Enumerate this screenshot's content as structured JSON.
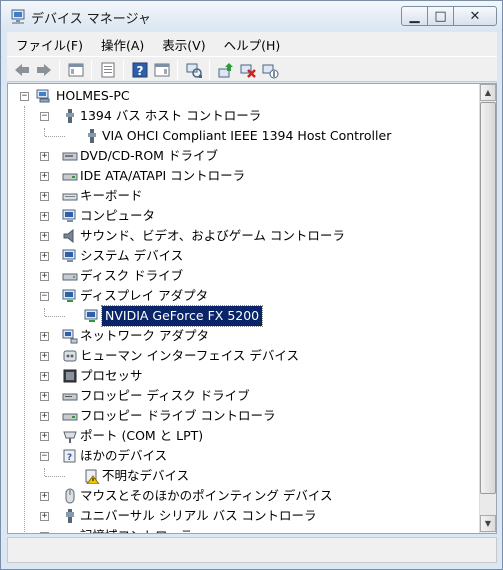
{
  "window": {
    "title": "デバイス マネージャ"
  },
  "menu": {
    "file": "ファイル(F)",
    "action": "操作(A)",
    "view": "表示(V)",
    "help": "ヘルプ(H)"
  },
  "window_buttons": {
    "minimize": "▁",
    "maximize": "□",
    "close": "✕"
  },
  "tree": {
    "root": "HOLMES-PC",
    "items": [
      {
        "label": "1394 バス ホスト コントローラ",
        "expanded": true,
        "icon": "1394-controller-icon"
      },
      {
        "label": "VIA OHCI Compliant IEEE 1394 Host Controller",
        "child": true,
        "icon": "1394-device-icon"
      },
      {
        "label": "DVD/CD-ROM ドライブ",
        "icon": "dvd-drive-icon"
      },
      {
        "label": "IDE ATA/ATAPI コントローラ",
        "icon": "ide-controller-icon"
      },
      {
        "label": "キーボード",
        "icon": "keyboard-icon"
      },
      {
        "label": "コンピュータ",
        "icon": "computer-icon"
      },
      {
        "label": "サウンド、ビデオ、およびゲーム コントローラ",
        "icon": "sound-icon"
      },
      {
        "label": "システム デバイス",
        "icon": "system-device-icon"
      },
      {
        "label": "ディスク ドライブ",
        "icon": "disk-drive-icon"
      },
      {
        "label": "ディスプレイ アダプタ",
        "expanded": true,
        "icon": "display-adapter-icon"
      },
      {
        "label": "NVIDIA GeForce FX 5200",
        "child": true,
        "selected": true,
        "icon": "display-device-icon"
      },
      {
        "label": "ネットワーク アダプタ",
        "icon": "network-adapter-icon"
      },
      {
        "label": "ヒューマン インターフェイス デバイス",
        "icon": "hid-icon"
      },
      {
        "label": "プロセッサ",
        "icon": "processor-icon"
      },
      {
        "label": "フロッピー ディスク ドライブ",
        "icon": "floppy-drive-icon"
      },
      {
        "label": "フロッピー ドライブ コントローラ",
        "icon": "floppy-controller-icon"
      },
      {
        "label": "ポート (COM と LPT)",
        "icon": "port-icon"
      },
      {
        "label": "ほかのデバイス",
        "expanded": true,
        "icon": "other-devices-icon"
      },
      {
        "label": "不明なデバイス",
        "child": true,
        "icon": "unknown-device-warning-icon"
      },
      {
        "label": "マウスとそのほかのポインティング デバイス",
        "icon": "mouse-icon"
      },
      {
        "label": "ユニバーサル シリアル バス コントローラ",
        "icon": "usb-controller-icon"
      },
      {
        "label": "記憶域コントローラ",
        "icon": "storage-controller-icon"
      }
    ]
  },
  "colors": {
    "selection": "#0a246a",
    "window_frame": "#dbe7f3"
  }
}
